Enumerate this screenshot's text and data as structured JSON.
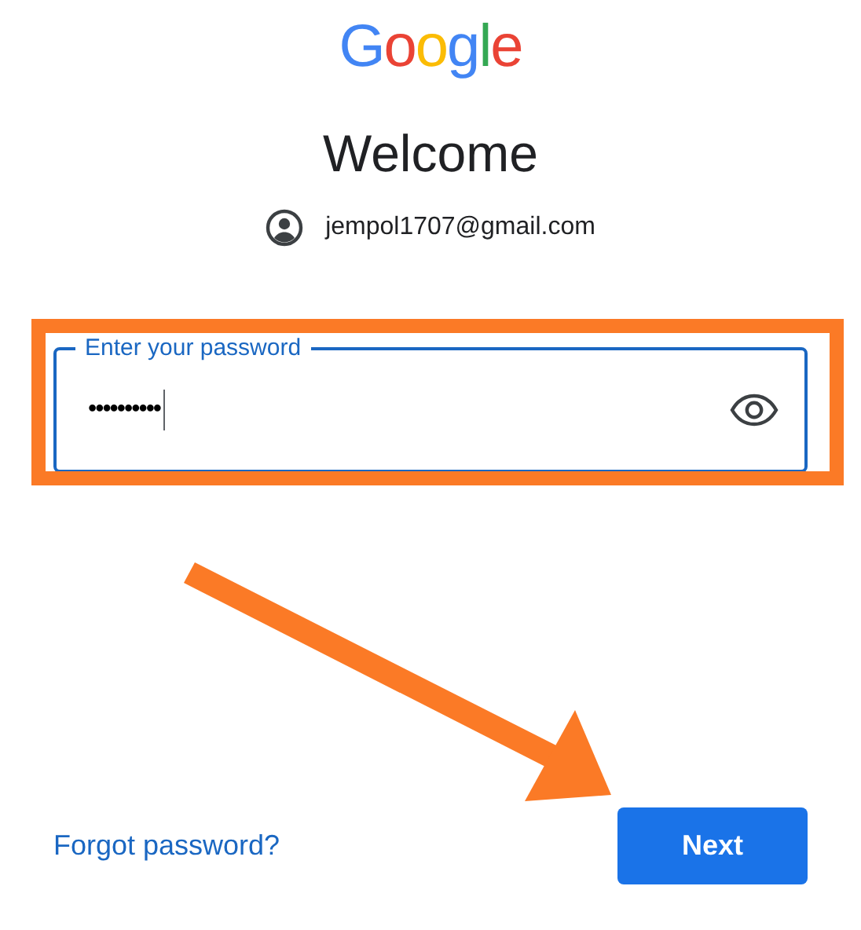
{
  "logo": {
    "text": "Google"
  },
  "title": "Welcome",
  "account": {
    "email": "jempol1707@gmail.com"
  },
  "password_field": {
    "label": "Enter your password",
    "value": "••••••••••",
    "focused": true
  },
  "forgot_link": "Forgot password?",
  "next_button": "Next"
}
